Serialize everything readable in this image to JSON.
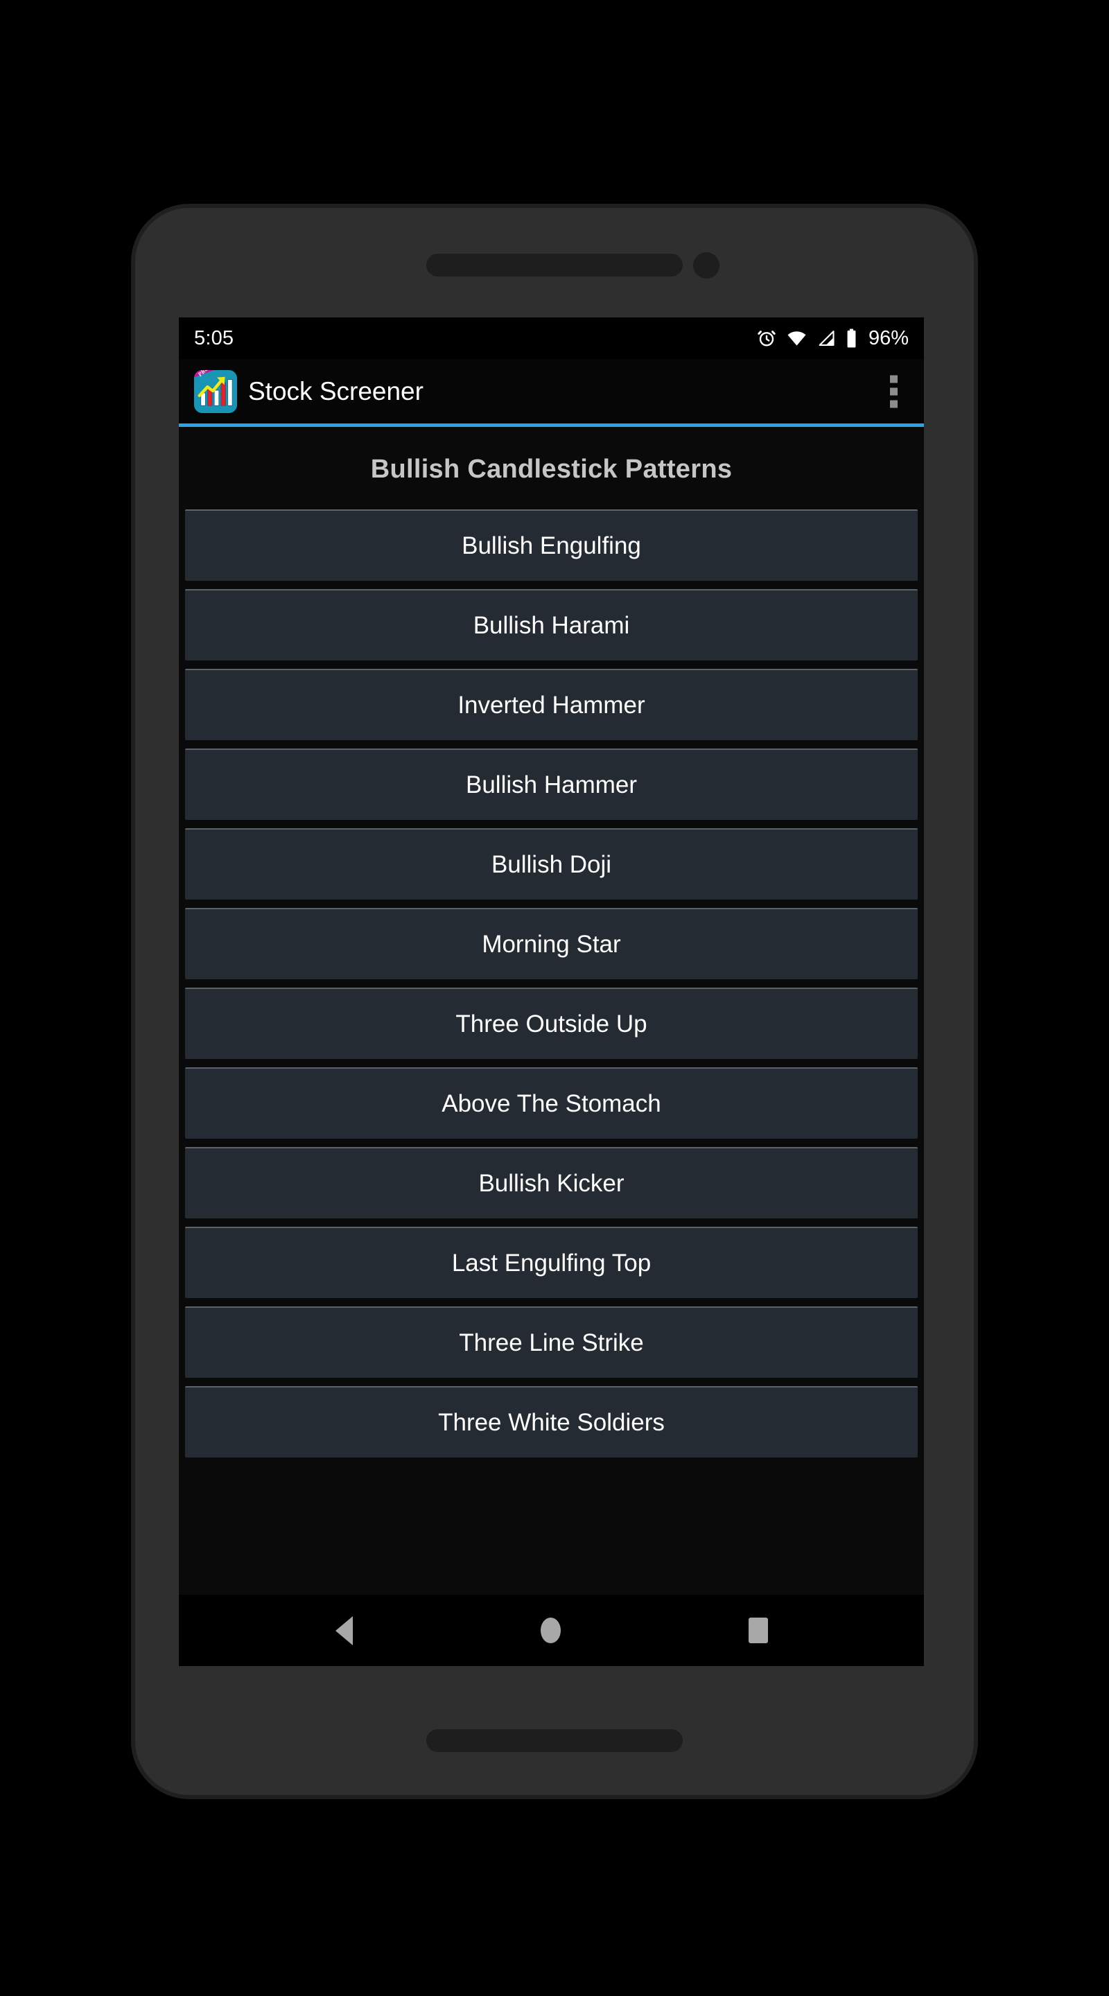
{
  "status_bar": {
    "time": "5:05",
    "battery_percent": "96%",
    "icons": [
      "alarm-icon",
      "wifi-icon",
      "cellular-signal-icon",
      "battery-icon"
    ]
  },
  "app_bar": {
    "title": "Stock Screener",
    "icon": "stock-screener-app-icon",
    "icon_badge": "PRO",
    "overflow_menu": "overflow-menu-icon",
    "accent_color": "#2aa3e8"
  },
  "content": {
    "heading": "Bullish Candlestick Patterns",
    "patterns": [
      {
        "label": "Bullish Engulfing"
      },
      {
        "label": "Bullish Harami"
      },
      {
        "label": "Inverted Hammer"
      },
      {
        "label": "Bullish Hammer"
      },
      {
        "label": "Bullish Doji"
      },
      {
        "label": "Morning Star"
      },
      {
        "label": "Three Outside Up"
      },
      {
        "label": "Above The Stomach"
      },
      {
        "label": "Bullish Kicker"
      },
      {
        "label": "Last Engulfing Top"
      },
      {
        "label": "Three Line Strike"
      },
      {
        "label": "Three White Soldiers"
      }
    ]
  },
  "nav_bar": {
    "back": "back-triangle-icon",
    "home": "home-circle-icon",
    "recents": "recents-square-icon"
  },
  "colors": {
    "screen_background": "#0a0a0a",
    "list_item_background": "#242b33",
    "list_item_border": "#5b636b",
    "heading_text": "#c6c6c6",
    "item_text": "#ffffff",
    "accent": "#2aa3e8"
  }
}
